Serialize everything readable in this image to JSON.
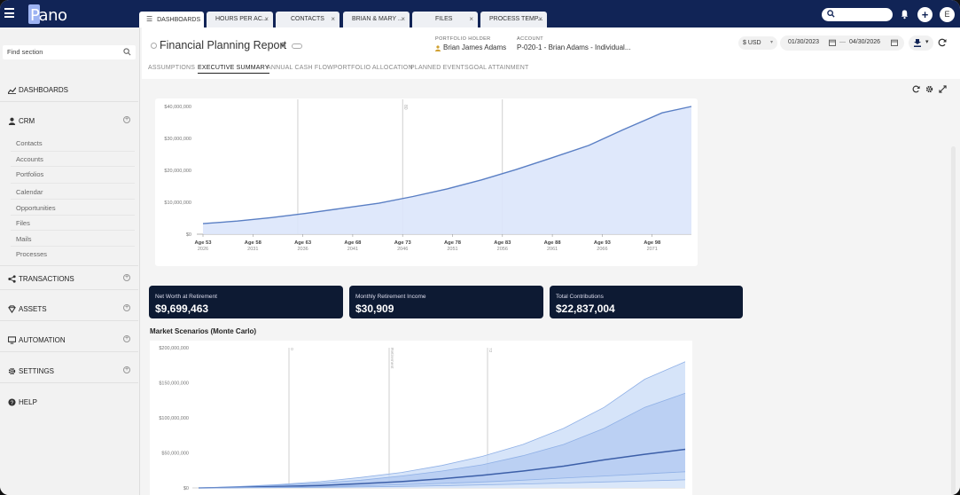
{
  "app": {
    "logo_text": "Pano"
  },
  "tabs": [
    {
      "label": "DASHBOARDS"
    },
    {
      "label": "HOURS PER AC..."
    },
    {
      "label": "CONTACTS"
    },
    {
      "label": "BRIAN & MARY ..."
    },
    {
      "label": "FILES"
    },
    {
      "label": "PROCESS TEMP..."
    }
  ],
  "topbar": {
    "avatar_initial": "E",
    "plus_label": "+"
  },
  "sidebar": {
    "search_placeholder": "Find section",
    "sections": [
      {
        "label": "DASHBOARDS",
        "icon": "chart-icon"
      },
      {
        "label": "CRM",
        "icon": "person-icon"
      },
      {
        "label": "TRANSACTIONS",
        "icon": "share-icon"
      },
      {
        "label": "ASSETS",
        "icon": "diamond-icon"
      },
      {
        "label": "AUTOMATION",
        "icon": "monitor-icon"
      },
      {
        "label": "SETTINGS",
        "icon": "gear-icon"
      },
      {
        "label": "HELP",
        "icon": "help-icon"
      }
    ],
    "crm_items": [
      "Contacts",
      "Accounts",
      "Portfolios",
      "Calendar",
      "Opportunities",
      "Files",
      "Mails",
      "Processes"
    ]
  },
  "header": {
    "title": "Financial Planning Report",
    "holder_label": "PORTFOLIO HOLDER",
    "holder_value": "Brian James Adams",
    "account_label": "ACCOUNT",
    "account_value": "P-020-1 - Brian Adams - Individual...",
    "currency": "$ USD",
    "date_from": "01/30/2023",
    "date_to": "04/30/2026",
    "date_sep": "—"
  },
  "subtabs": [
    "ASSUMPTIONS",
    "EXECUTIVE SUMMARY",
    "ANNUAL CASH FLOW",
    "PORTFOLIO ALLOCATION",
    "PLANNED EVENTS",
    "GOAL ATTAINMENT"
  ],
  "kpis": [
    {
      "label": "Net Worth at Retirement",
      "value": "$9,699,463"
    },
    {
      "label": "Monthly Retirement Income",
      "value": "$30,909"
    },
    {
      "label": "Total Contributions",
      "value": "$22,837,004"
    }
  ],
  "monte_carlo_title": "Market Scenarios (Monte Carlo)",
  "chart_data": [
    {
      "type": "area",
      "title": "",
      "x_categories": [
        {
          "age": "Age 53",
          "year": "2026"
        },
        {
          "age": "Age 58",
          "year": "2031"
        },
        {
          "age": "Age 63",
          "year": "2036"
        },
        {
          "age": "Age 68",
          "year": "2041"
        },
        {
          "age": "Age 73",
          "year": "2046"
        },
        {
          "age": "Age 78",
          "year": "2051"
        },
        {
          "age": "Age 83",
          "year": "2056"
        },
        {
          "age": "Age 88",
          "year": "2061"
        },
        {
          "age": "Age 93",
          "year": "2066"
        },
        {
          "age": "Age 98",
          "year": "2071"
        }
      ],
      "y_ticks": [
        "$0",
        "$10,000,000",
        "$20,000,000",
        "$30,000,000",
        "$40,000,000"
      ],
      "ylim": [
        0,
        40000000
      ],
      "vlines_at_category": [
        1.9,
        4.0,
        6.0
      ],
      "vline_labels": [
        "",
        "80",
        ""
      ],
      "series": [
        {
          "values": [
            3300000,
            4100000,
            5200000,
            6500000,
            8000000,
            9700000,
            11800000,
            14200000,
            17000000,
            20200000,
            23700000,
            27800000,
            32700000,
            38000000,
            40000000
          ],
          "x_fraction": [
            0,
            0.07,
            0.14,
            0.21,
            0.28,
            0.36,
            0.43,
            0.5,
            0.57,
            0.64,
            0.71,
            0.79,
            0.86,
            0.94,
            1.0
          ]
        }
      ],
      "colors": {
        "line": "#5a7fc4",
        "fill": "#dbe5fb"
      }
    },
    {
      "type": "area",
      "title": "Market Scenarios (Monte Carlo)",
      "y_ticks": [
        "$0",
        "$50,000,000",
        "$100,000,000",
        "$150,000,000",
        "$200,000,000"
      ],
      "ylim": [
        0,
        200000000
      ],
      "vline_labels": [
        "0",
        "Retirement",
        "72"
      ],
      "series": [
        {
          "values": [
            0,
            2000000,
            5000000,
            9000000,
            15000000,
            22000000,
            32000000,
            45000000,
            62000000,
            85000000,
            115000000,
            155000000,
            180000000
          ]
        },
        {
          "values": [
            0,
            1500000,
            4000000,
            7000000,
            11000000,
            17000000,
            24000000,
            33000000,
            46000000,
            62000000,
            85000000,
            115000000,
            135000000
          ]
        },
        {
          "values": [
            0,
            800000,
            2000000,
            3500000,
            6000000,
            9000000,
            13000000,
            18000000,
            24000000,
            31000000,
            40000000,
            48000000,
            55000000
          ]
        },
        {
          "values": [
            0,
            400000,
            1000000,
            1800000,
            3000000,
            4500000,
            6500000,
            8500000,
            11000000,
            14000000,
            17000000,
            20000000,
            23000000
          ]
        },
        {
          "values": [
            0,
            200000,
            500000,
            900000,
            1500000,
            2200000,
            3200000,
            4300000,
            5600000,
            7000000,
            8500000,
            10000000,
            11500000
          ]
        }
      ],
      "colors": {
        "outer": "#c8dbf7",
        "inner": "#a9c3ef",
        "median": "#3c5fa8"
      }
    }
  ]
}
